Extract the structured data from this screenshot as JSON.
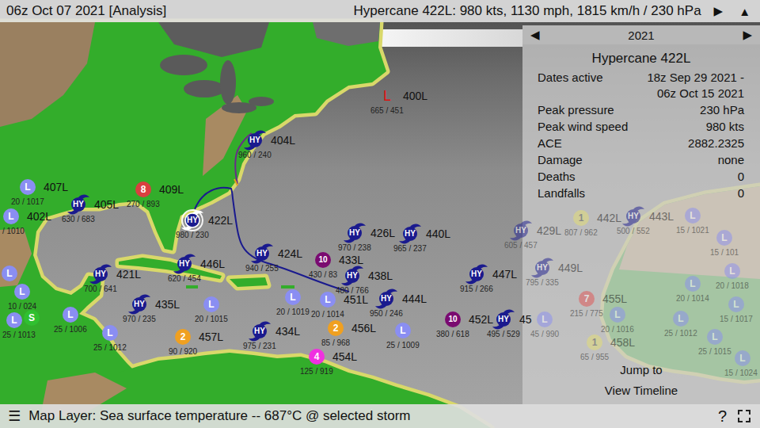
{
  "top_bar": {
    "datetime": "06z Oct 07 2021 [Analysis]",
    "storm_summary": "Hypercane 422L: 980 kts, 1130 mph, 1815 km/h / 230 hPa",
    "play_button": "▶",
    "collapse_button": "▲"
  },
  "panel": {
    "prev_button": "◀",
    "year": "2021",
    "next_button": "▶",
    "title": "Hypercane 422L",
    "stats": [
      {
        "label": "Dates active",
        "value": "18z Sep 29 2021 - 06z Oct 15 2021"
      },
      {
        "label": "Peak pressure",
        "value": "230 hPa"
      },
      {
        "label": "Peak wind speed",
        "value": "980 kts"
      },
      {
        "label": "ACE",
        "value": "2882.2325"
      },
      {
        "label": "Damage",
        "value": "none"
      },
      {
        "label": "Deaths",
        "value": "0"
      },
      {
        "label": "Landfalls",
        "value": "0"
      }
    ],
    "jump_to": "Jump to",
    "view_timeline": "View Timeline"
  },
  "storms": [
    {
      "symbol": "L",
      "name": "400L",
      "reading": "665 / 451",
      "color": "#e01010",
      "kind": "letter",
      "selected": false
    },
    {
      "symbol": "HY",
      "name": "404L",
      "reading": "960 / 240",
      "color": "#1a1a8e",
      "kind": "swirl",
      "selected": false
    },
    {
      "symbol": "L",
      "name": "407L",
      "reading": "20 / 1017",
      "color": "#8a8ef2",
      "kind": "circle",
      "selected": false
    },
    {
      "symbol": "L",
      "name": "402L",
      "reading": "/ 1010",
      "color": "#8a8ef2",
      "kind": "circle",
      "selected": false
    },
    {
      "symbol": "HY",
      "name": "405L",
      "reading": "630 / 683",
      "color": "#1a1a8e",
      "kind": "swirl",
      "selected": false
    },
    {
      "symbol": "8",
      "name": "409L",
      "reading": "270 / 893",
      "color": "#d94040",
      "kind": "circle",
      "selected": false
    },
    {
      "symbol": "HY",
      "name": "422L",
      "reading": "980 / 230",
      "color": "#1a1a8e",
      "kind": "swirl",
      "selected": true
    },
    {
      "symbol": "HY",
      "name": "424L",
      "reading": "940 / 255",
      "color": "#1a1a8e",
      "kind": "swirl",
      "selected": false
    },
    {
      "symbol": "HY",
      "name": "446L",
      "reading": "620 / 454",
      "color": "#1a1a8e",
      "kind": "swirl",
      "selected": false
    },
    {
      "symbol": "HY",
      "name": "421L",
      "reading": "700 / 641",
      "color": "#1a1a8e",
      "kind": "swirl",
      "selected": false
    },
    {
      "symbol": "HY",
      "name": "435L",
      "reading": "970 / 235",
      "color": "#1a1a8e",
      "kind": "swirl",
      "selected": false
    },
    {
      "symbol": "L",
      "reading": "20 / 1015",
      "color": "#8a8ef2",
      "kind": "circle",
      "selected": false
    },
    {
      "symbol": "HY",
      "name": "426L",
      "reading": "970 / 238",
      "color": "#1a1a8e",
      "kind": "swirl",
      "selected": false
    },
    {
      "symbol": "HY",
      "name": "440L",
      "reading": "965 / 237",
      "color": "#1a1a8e",
      "kind": "swirl",
      "selected": false
    },
    {
      "symbol": "10",
      "name": "433L",
      "reading": "430 / 83",
      "color": "#7a0a70",
      "kind": "circle",
      "selected": false
    },
    {
      "symbol": "HY",
      "name": "438L",
      "reading": "480 / 766",
      "color": "#1a1a8e",
      "kind": "swirl",
      "selected": false
    },
    {
      "symbol": "L",
      "reading": "20 / 1019",
      "color": "#8a8ef2",
      "kind": "circle",
      "selected": false
    },
    {
      "symbol": "L",
      "name": "451L",
      "reading": "20 / 1014",
      "color": "#8a8ef2",
      "kind": "circle",
      "selected": false
    },
    {
      "symbol": "2",
      "name": "456L",
      "reading": "85 / 968",
      "color": "#f0a020",
      "kind": "circle",
      "selected": false
    },
    {
      "symbol": "4",
      "name": "454L",
      "reading": "125 / 919",
      "color": "#f030e0",
      "kind": "circle",
      "selected": false
    },
    {
      "symbol": "HY",
      "name": "444L",
      "reading": "950 / 246",
      "color": "#1a1a8e",
      "kind": "swirl",
      "selected": false
    },
    {
      "symbol": "L",
      "reading": "25 / 1009",
      "color": "#8a8ef2",
      "kind": "circle",
      "selected": false
    },
    {
      "symbol": "HY",
      "name": "434L",
      "reading": "975 / 231",
      "color": "#1a1a8e",
      "kind": "swirl",
      "selected": false
    },
    {
      "symbol": "2",
      "name": "457L",
      "reading": "90 / 920",
      "color": "#f0a020",
      "kind": "circle",
      "selected": false
    },
    {
      "symbol": "L",
      "reading": "25 / 1012",
      "color": "#8a8ef2",
      "kind": "circle",
      "selected": false
    },
    {
      "symbol": "L",
      "reading": "25 / 1006",
      "color": "#8a8ef2",
      "kind": "circle",
      "selected": false
    },
    {
      "symbol": "L",
      "color": "#8a8ef2",
      "kind": "circle",
      "selected": false
    },
    {
      "symbol": "L",
      "reading": "10 / 024",
      "color": "#8a8ef2",
      "kind": "circle",
      "selected": false
    },
    {
      "symbol": "L",
      "reading": "25 / 1013",
      "color": "#8a8ef2",
      "kind": "circle",
      "selected": false
    },
    {
      "symbol": "S",
      "color": "#30c030",
      "kind": "circle",
      "selected": false
    },
    {
      "symbol": "HY",
      "name": "429L",
      "reading": "605 / 457",
      "color": "#1a1a8e",
      "kind": "swirl",
      "selected": false
    },
    {
      "symbol": "HY",
      "name": "447L",
      "reading": "915 / 266",
      "color": "#1a1a8e",
      "kind": "swirl",
      "selected": false
    },
    {
      "symbol": "10",
      "name": "452L",
      "reading": "380 / 618",
      "color": "#7a0a70",
      "kind": "circle",
      "selected": false
    },
    {
      "symbol": "HY",
      "name": "45",
      "reading": "495 / 529",
      "color": "#1a1a8e",
      "kind": "swirl",
      "selected": false
    },
    {
      "symbol": "L",
      "reading": "45 / 990",
      "color": "#8a8ef2",
      "kind": "circle",
      "selected": false
    },
    {
      "symbol": "1",
      "name": "442L",
      "reading": "807 / 962",
      "color": "#e6e070",
      "kind": "circle",
      "selected": false
    },
    {
      "symbol": "HY",
      "name": "443L",
      "reading": "500 / 552",
      "color": "#1a1a8e",
      "kind": "swirl",
      "selected": false
    },
    {
      "symbol": "HY",
      "name": "449L",
      "reading": "795 / 335",
      "color": "#1a1a8e",
      "kind": "swirl",
      "selected": false
    },
    {
      "symbol": "7",
      "name": "455L",
      "reading": "215 / 775",
      "color": "#e05050",
      "kind": "circle",
      "selected": false
    },
    {
      "symbol": "1",
      "name": "458L",
      "reading": "65 / 955",
      "color": "#e6e070",
      "kind": "circle",
      "selected": false
    },
    {
      "symbol": "L",
      "reading": "20 / 1016",
      "color": "#8a8ef2",
      "kind": "circle",
      "selected": false
    },
    {
      "symbol": "L",
      "reading": "15 / 1021",
      "color": "#8a8ef2",
      "kind": "circle",
      "selected": false
    },
    {
      "symbol": "L",
      "reading": "15 / 101",
      "color": "#8a8ef2",
      "kind": "circle",
      "selected": false
    },
    {
      "symbol": "L",
      "reading": "20 / 1018",
      "color": "#8a8ef2",
      "kind": "circle",
      "selected": false
    },
    {
      "symbol": "L",
      "reading": "20 / 1014",
      "color": "#8a8ef2",
      "kind": "circle",
      "selected": false
    },
    {
      "symbol": "L",
      "reading": "15 / 1017",
      "color": "#8a8ef2",
      "kind": "circle",
      "selected": false
    },
    {
      "symbol": "L",
      "reading": "25 / 1012",
      "color": "#8a8ef2",
      "kind": "circle",
      "selected": false
    },
    {
      "symbol": "L",
      "reading": "25 / 1015",
      "color": "#8a8ef2",
      "kind": "circle",
      "selected": false
    },
    {
      "symbol": "L",
      "reading": "15 / 1024",
      "color": "#8a8ef2",
      "kind": "circle",
      "selected": false
    }
  ],
  "bottom_bar": {
    "menu_button": "☰",
    "map_layer": "Map Layer: Sea surface temperature -- 687°C @ selected storm",
    "help_button": "?"
  }
}
